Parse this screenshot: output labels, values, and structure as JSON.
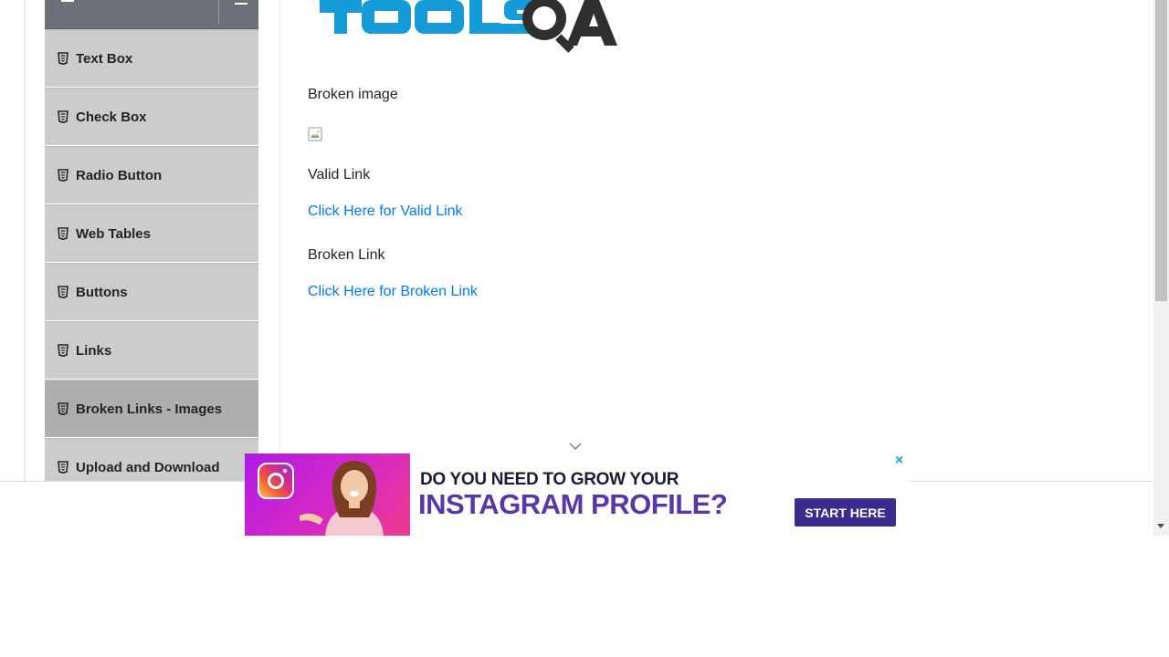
{
  "sidebar": {
    "items": [
      {
        "label": "Text Box",
        "icon": "html5-icon",
        "active": false
      },
      {
        "label": "Check Box",
        "icon": "html5-icon",
        "active": false
      },
      {
        "label": "Radio Button",
        "icon": "html5-icon",
        "active": false
      },
      {
        "label": "Web Tables",
        "icon": "html5-icon",
        "active": false
      },
      {
        "label": "Buttons",
        "icon": "html5-icon",
        "active": false
      },
      {
        "label": "Links",
        "icon": "html5-icon",
        "active": false
      },
      {
        "label": "Broken Links - Images",
        "icon": "html5-icon",
        "active": true
      },
      {
        "label": "Upload and Download",
        "icon": "html5-icon",
        "active": false
      }
    ]
  },
  "logo": {
    "text": "TOOLSQA"
  },
  "main": {
    "broken_image_label": "Broken image",
    "valid_link_label": "Valid Link",
    "valid_link_text": "Click Here for Valid Link",
    "broken_link_label": "Broken Link",
    "broken_link_text": "Click Here for Broken Link"
  },
  "ad": {
    "headline_line1": "DO YOU NEED TO GROW YOUR",
    "headline_line2": "INSTAGRAM PROFILE?",
    "cta_label": "START HERE",
    "close_glyph": "×"
  },
  "colors": {
    "link": "#007bff",
    "sidebar_item": "#cccccc",
    "sidebar_active": "#aeaeae",
    "sidebar_header": "#6b7079",
    "cta": "#3c2b8f"
  }
}
